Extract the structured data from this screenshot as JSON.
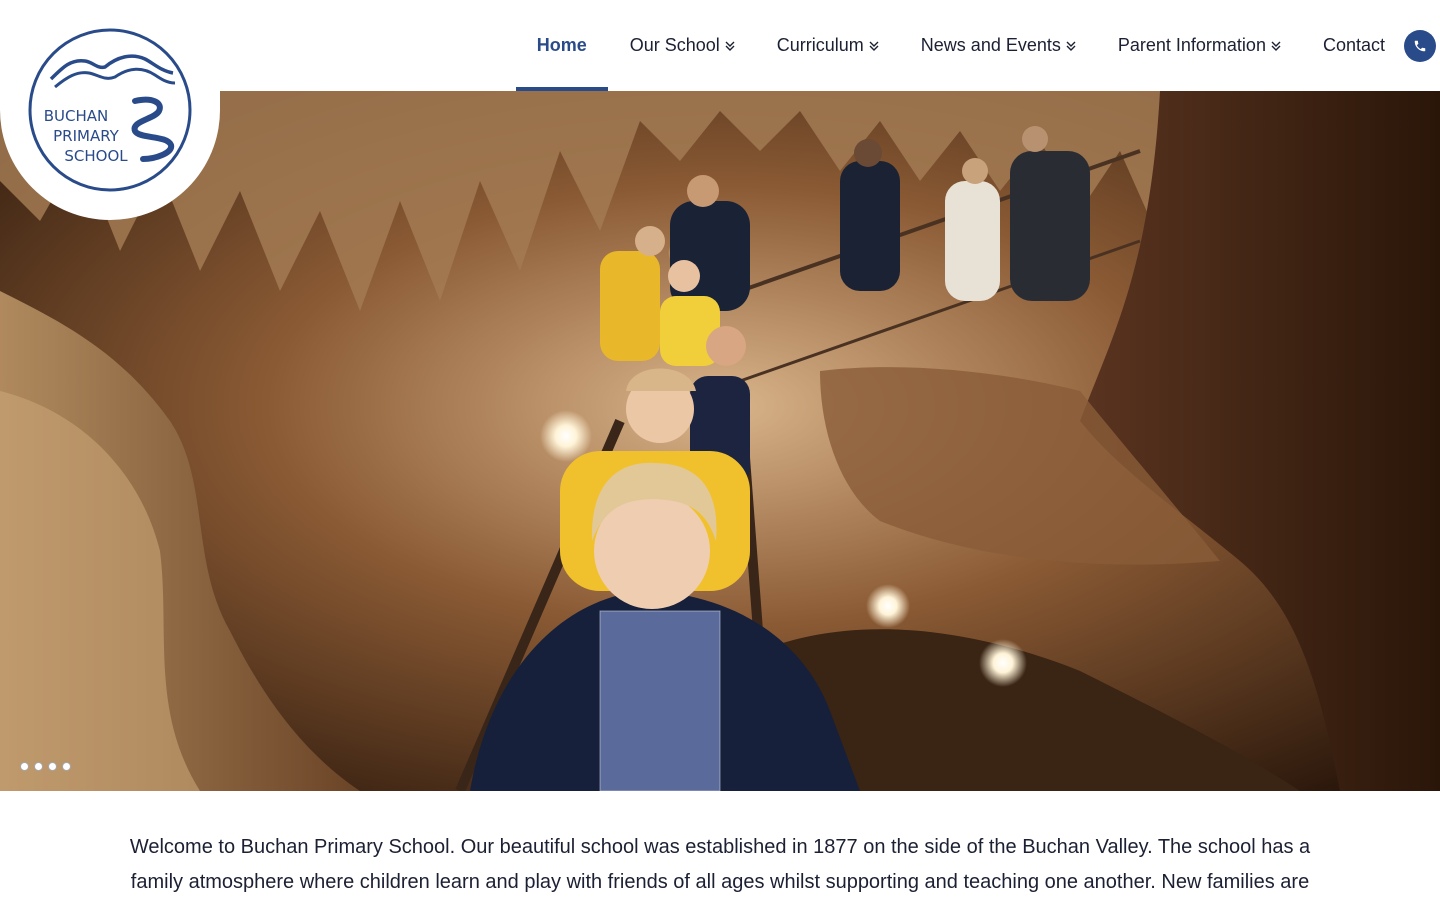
{
  "logo": {
    "line1": "BUCHAN",
    "line2": "PRIMARY",
    "line3": "SCHOOL"
  },
  "nav": {
    "home": "Home",
    "our_school": "Our School",
    "curriculum": "Curriculum",
    "news_events": "News and Events",
    "parent_info": "Parent Information",
    "contact": "Contact"
  },
  "icons": {
    "phone": "phone-icon",
    "dropdown": "double-chevron-down-icon"
  },
  "colors": {
    "brand": "#2a4b8a",
    "text": "#1c2033"
  },
  "hero": {
    "slides": 4,
    "active_slide": 1
  },
  "intro": {
    "text": "Welcome to Buchan Primary School. Our beautiful school was established in 1877 on the side of the Buchan Valley. The school has a family atmosphere where children learn and play with friends of all ages whilst supporting and teaching one another. New families are"
  }
}
